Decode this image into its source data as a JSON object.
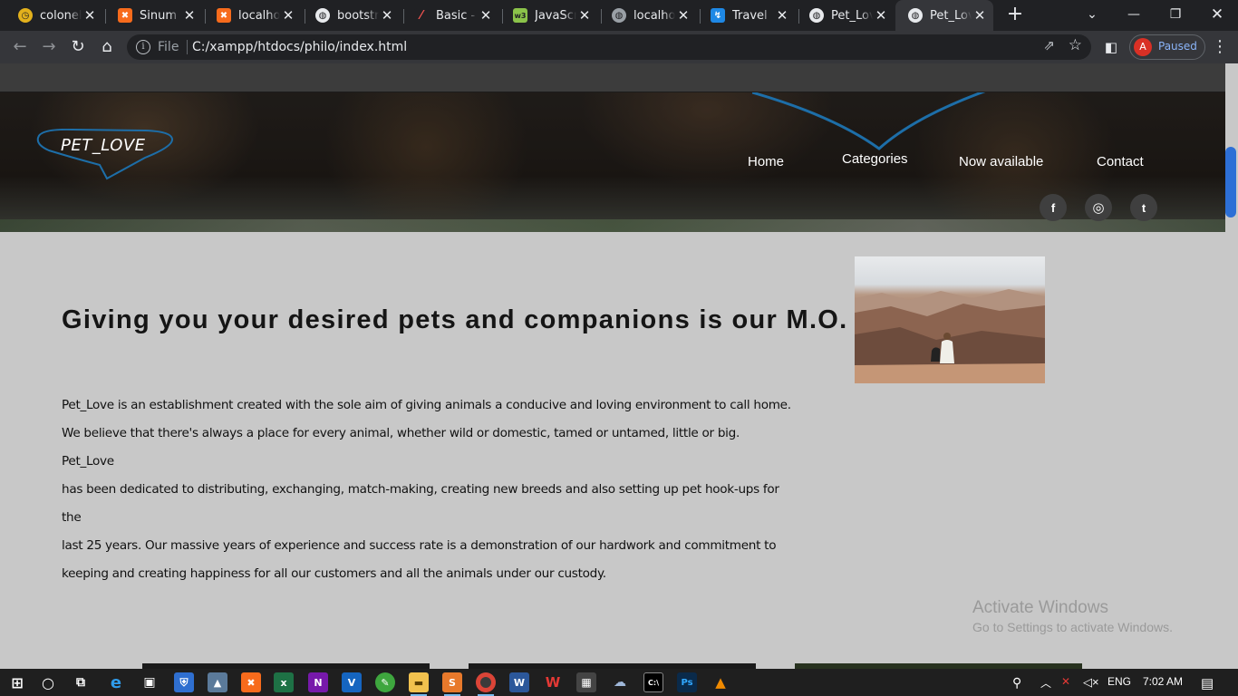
{
  "browser": {
    "tabs": [
      {
        "title": "coloneli",
        "favicon": "clock-favicon",
        "color": "#e3b11c"
      },
      {
        "title": "Sinum re",
        "favicon": "xampp-favicon",
        "color": "#f76b1c"
      },
      {
        "title": "localhos",
        "favicon": "xampp-favicon",
        "color": "#f76b1c"
      },
      {
        "title": "bootstra",
        "favicon": "globe-favicon",
        "color": "#ffffff"
      },
      {
        "title": "Basic - S",
        "favicon": "scrimba-favicon",
        "color": "#ef5350"
      },
      {
        "title": "JavaScri",
        "favicon": "w3-favicon",
        "color": "#8bc34a"
      },
      {
        "title": "localhos",
        "favicon": "globe-favicon",
        "color": "#9aa0a6"
      },
      {
        "title": "Travel",
        "favicon": "travel-favicon",
        "color": "#1e88e5"
      },
      {
        "title": "Pet_Love",
        "favicon": "globe-favicon",
        "color": "#ffffff"
      },
      {
        "title": "Pet_Love",
        "favicon": "globe-favicon",
        "color": "#ffffff",
        "active": true
      }
    ],
    "url_scheme_label": "File",
    "url": "C:/xampp/htdocs/philo/index.html",
    "profile_initial": "A",
    "profile_status": "Paused"
  },
  "site": {
    "logo": "PET_LOVE",
    "nav": {
      "home": "Home",
      "categories": "Categories",
      "now_available": "Now available",
      "contact": "Contact"
    },
    "social": {
      "facebook": "f",
      "instagram": "◎",
      "twitter": "t"
    },
    "headline": "Giving you your desired pets and companions is our M.O.",
    "about_lines": [
      "Pet_Love is an establishment created with the sole aim of giving animals a conducive and loving environment to call home.",
      "We believe that there's always a place for every animal, whether wild or domestic, tamed or untamed, little or big. Pet_Love",
      "has been dedicated to distributing, exchanging, match-making, creating new breeds and also setting up pet hook-ups for the",
      "last 25 years. Our massive years of experience and success rate is a demonstration of our hardwork and commitment to",
      "keeping and creating happiness for all our customers and all the animals under our custody."
    ]
  },
  "watermark": {
    "title": "Activate Windows",
    "subtitle": "Go to Settings to activate Windows."
  },
  "taskbar": {
    "apps": [
      "start",
      "search",
      "task-view",
      "edge",
      "store",
      "defender",
      "photos",
      "xampp",
      "excel",
      "onenote",
      "vscode",
      "green-app",
      "file-explorer",
      "sublime",
      "chrome",
      "word",
      "wps",
      "calculator",
      "cloud-app",
      "cmd",
      "photoshop",
      "vlc"
    ],
    "language": "ENG",
    "time": "7:02 AM"
  },
  "colors": {
    "accent_blue": "#1d6ea8",
    "content_bg": "#c8c8c8",
    "chrome_dark": "#202124"
  }
}
